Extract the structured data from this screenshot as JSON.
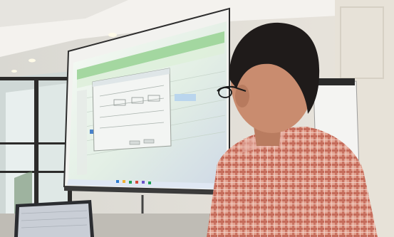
{
  "scene": {
    "colors": {
      "wall": "#e3e0da",
      "ceiling": "#f1efea",
      "screen_glow": "#e9f1ea",
      "excel_green": "#9ed59a",
      "dialog": "#eef0ee",
      "taskbar": "#dfe7f3",
      "shirt": "#d98c79",
      "hair": "#1f1b1a",
      "skin": "#c98c6f"
    },
    "icons": [
      "person-head",
      "projector-screen",
      "laptop",
      "ceiling-light",
      "glass-door",
      "flipchart"
    ]
  }
}
